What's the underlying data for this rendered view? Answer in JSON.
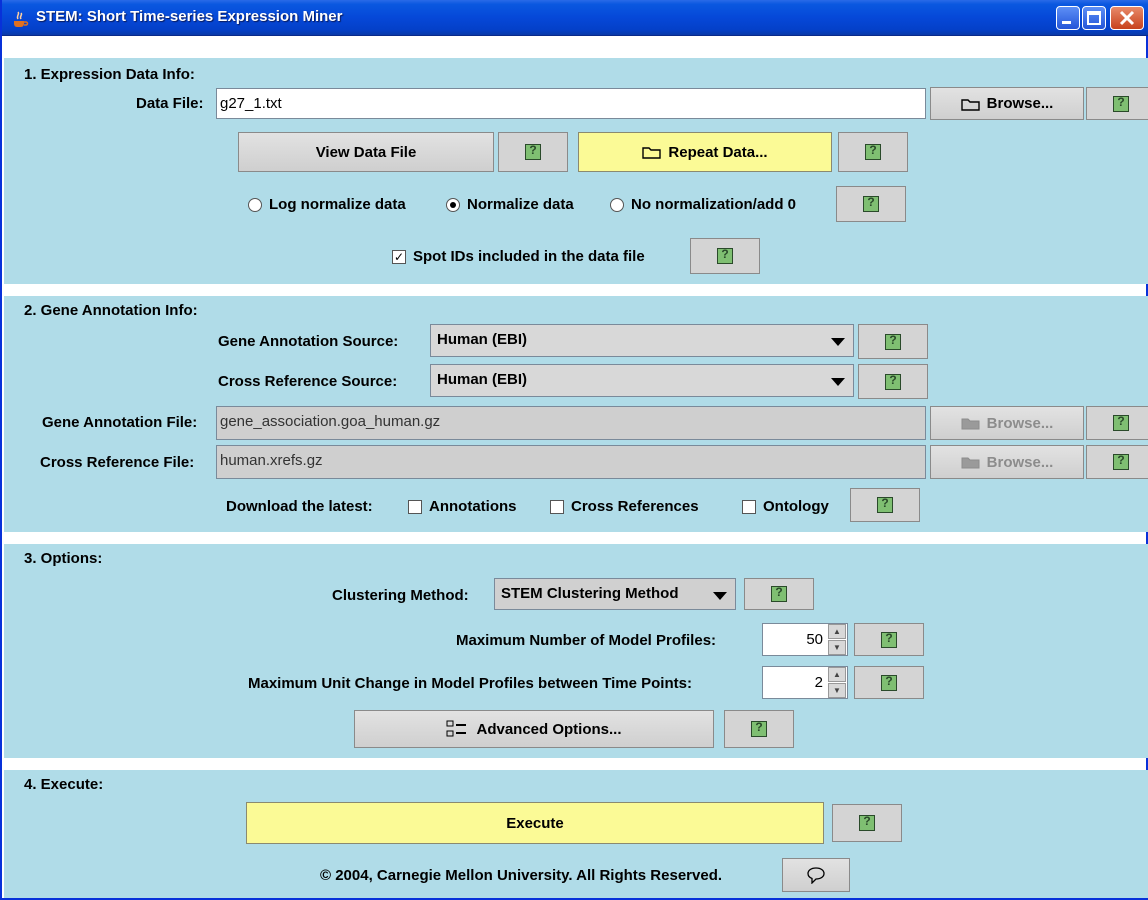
{
  "window": {
    "title": "STEM: Short Time-series Expression Miner"
  },
  "section1": {
    "title": "1. Expression Data Info:",
    "data_file_label": "Data File:",
    "data_file_value": "g27_1.txt",
    "browse_label": "Browse...",
    "view_data_label": "View Data File",
    "repeat_data_label": "Repeat Data...",
    "norm_options": [
      "Log normalize data",
      "Normalize data",
      "No normalization/add 0"
    ],
    "selected_norm": "Normalize data",
    "spot_ids_label": "Spot IDs included in the data file",
    "spot_ids_checked": true
  },
  "section2": {
    "title": "2. Gene Annotation Info:",
    "annotation_source_label": "Gene Annotation Source:",
    "annotation_source_value": "Human (EBI)",
    "cross_ref_source_label": "Cross Reference Source:",
    "cross_ref_source_value": "Human (EBI)",
    "annotation_file_label": "Gene Annotation File:",
    "annotation_file_value": "gene_association.goa_human.gz",
    "cross_ref_file_label": "Cross Reference File:",
    "cross_ref_file_value": "human.xrefs.gz",
    "browse_label": "Browse...",
    "download_label": "Download the latest:",
    "download_options": [
      "Annotations",
      "Cross References",
      "Ontology"
    ]
  },
  "section3": {
    "title": "3. Options:",
    "clustering_label": "Clustering Method:",
    "clustering_value": "STEM Clustering Method",
    "max_profiles_label": "Maximum Number of Model Profiles:",
    "max_profiles_value": "50",
    "max_unit_change_label": "Maximum Unit Change in Model Profiles between Time Points:",
    "max_unit_change_value": "2",
    "advanced_label": "Advanced Options..."
  },
  "section4": {
    "title": "4. Execute:",
    "execute_label": "Execute",
    "copyright": "© 2004, Carnegie Mellon University.  All Rights Reserved."
  },
  "colors": {
    "panel": "#b0dce8",
    "highlight_button": "#fbfa96",
    "titlebar": "#0648d8"
  }
}
